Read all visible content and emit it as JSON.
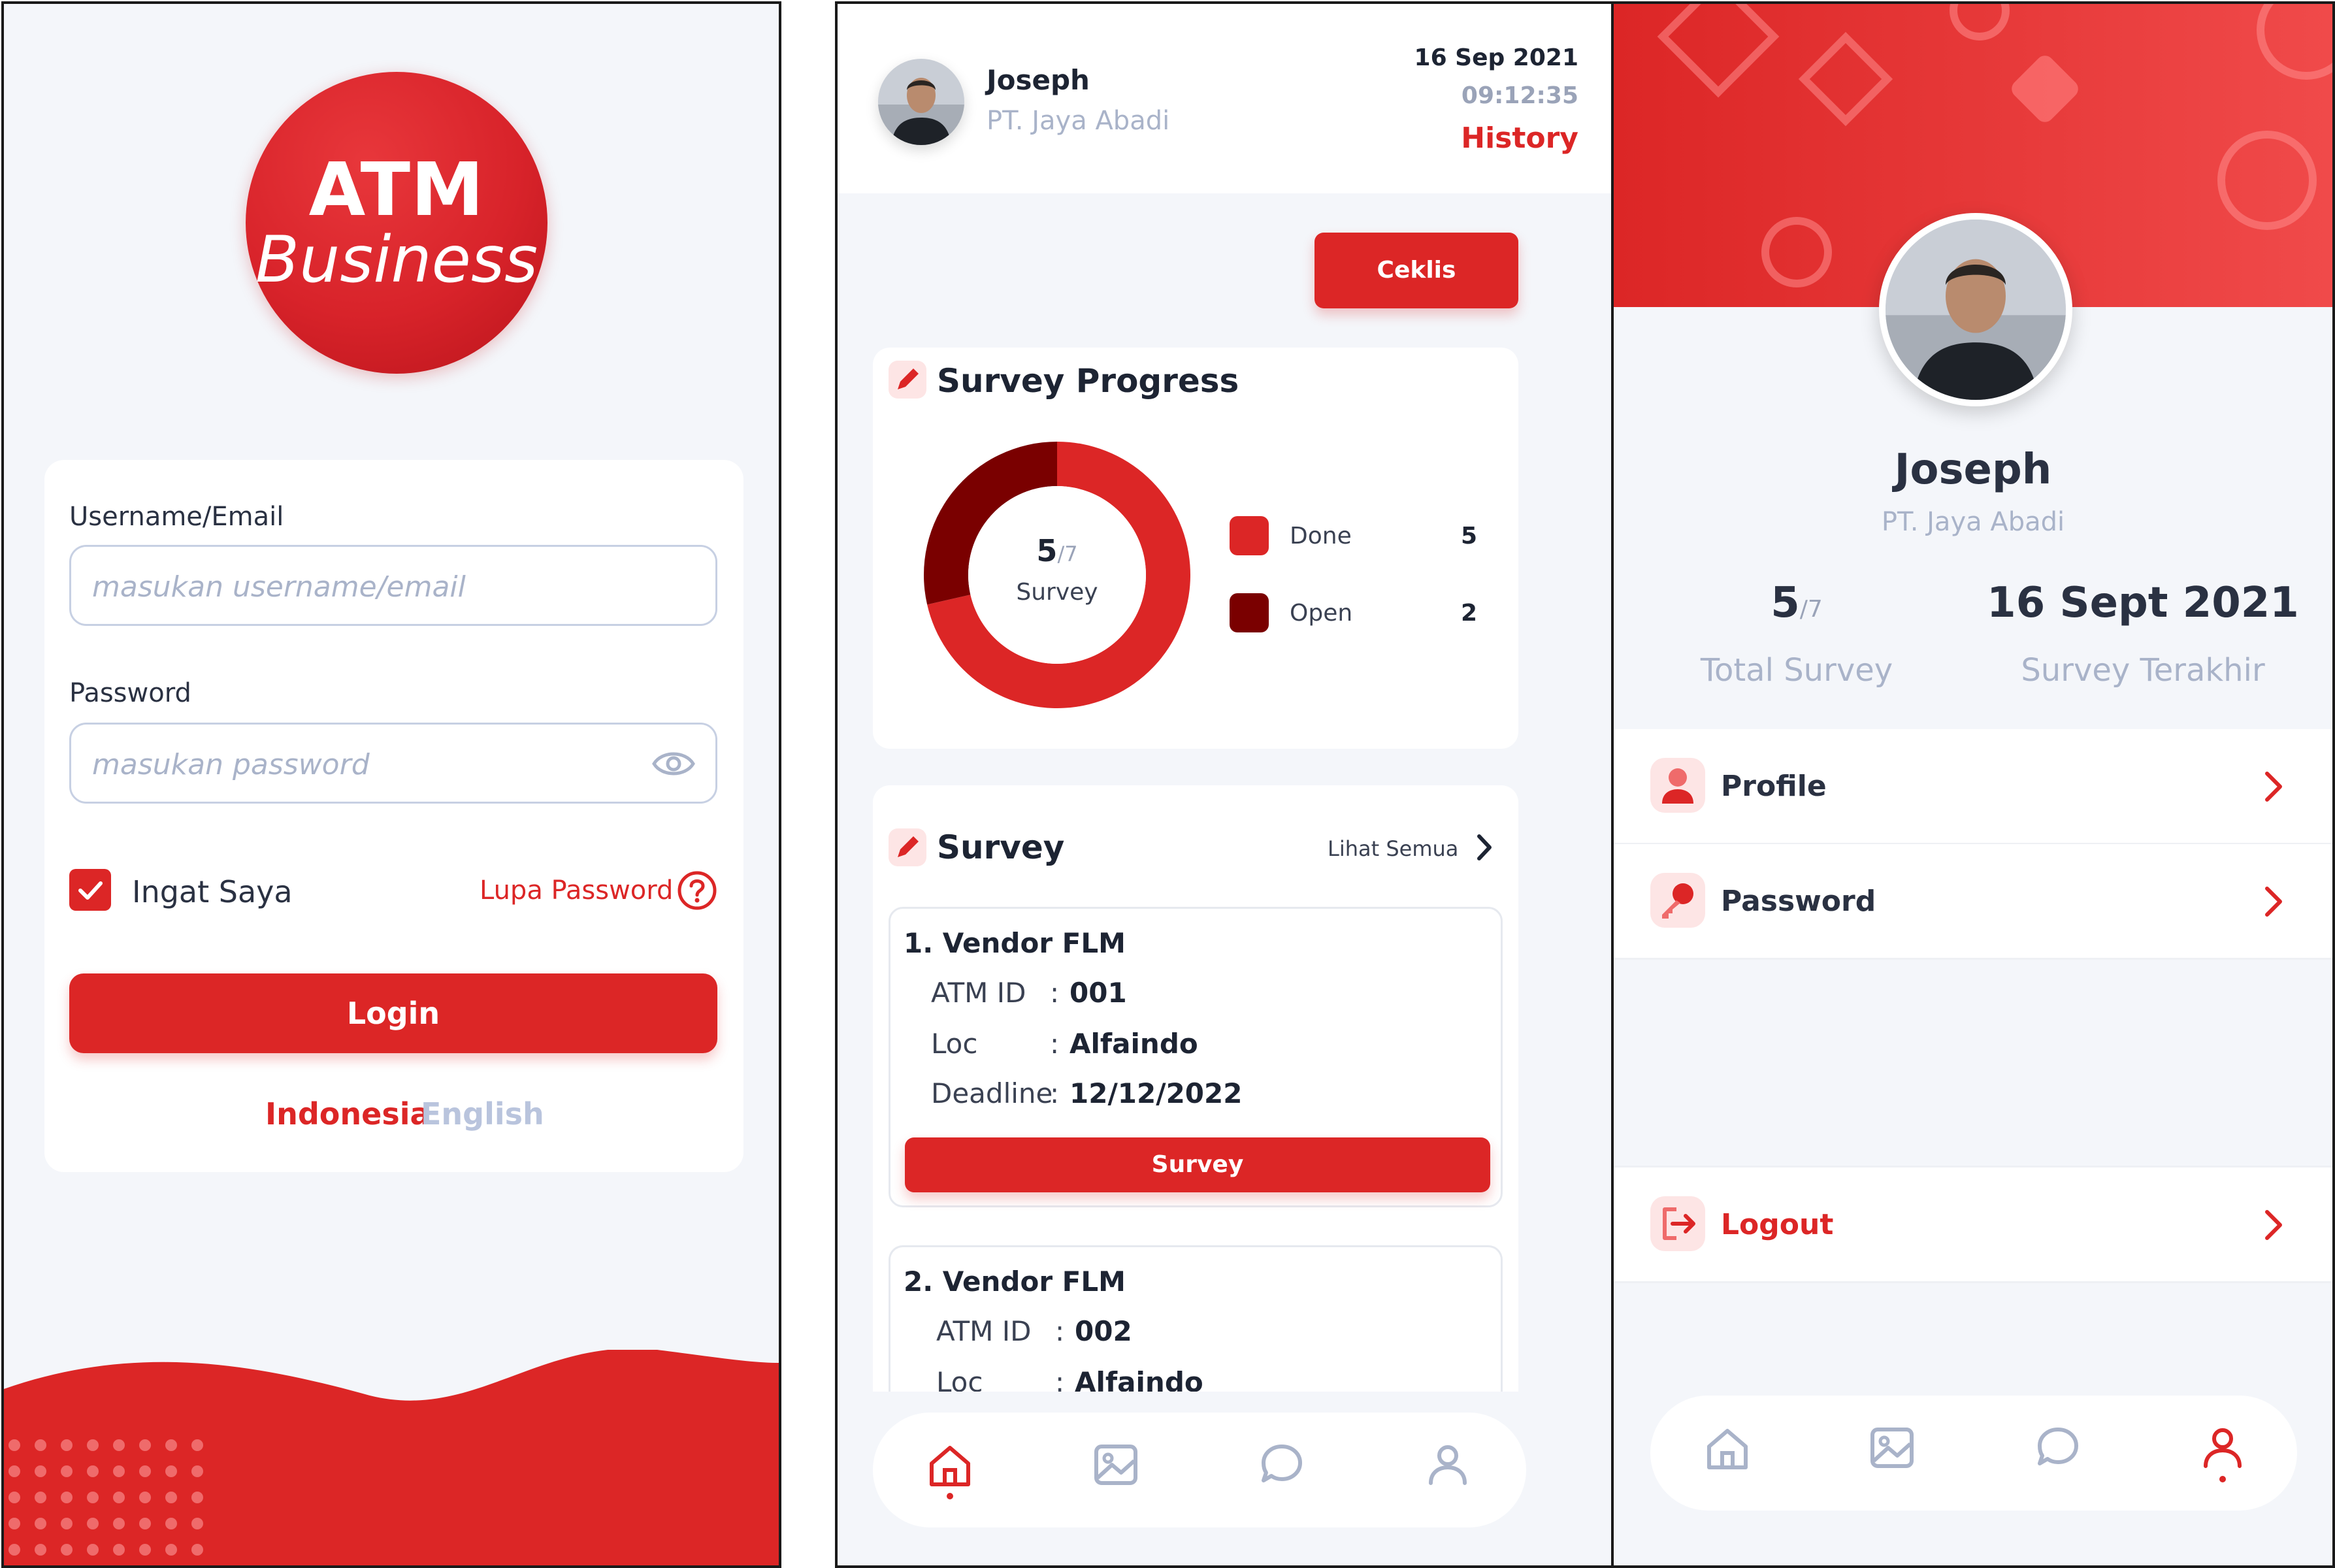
{
  "login": {
    "logo_line1": "ATM",
    "logo_line2": "Business",
    "username_label": "Username/Email",
    "username_placeholder": "masukan username/email",
    "password_label": "Password",
    "password_placeholder": "masukan password",
    "remember_label": "Ingat Saya",
    "remember_checked": true,
    "forgot_label": "Lupa Password",
    "login_button": "Login",
    "lang_id": "Indonesia",
    "lang_en": "English",
    "active_lang": "Indonesia"
  },
  "dashboard": {
    "user_name": "Joseph",
    "company": "PT. Jaya Abadi",
    "date": "16 Sep 2021",
    "time": "09:12:35",
    "history_link": "History",
    "ceklis_button": "Ceklis",
    "progress_title": "Survey Progress",
    "progress_center_value": "5",
    "progress_center_total": "/7",
    "progress_center_label": "Survey",
    "legend": [
      {
        "label": "Done",
        "value": "5",
        "color": "#dc2626"
      },
      {
        "label": "Open",
        "value": "2",
        "color": "#7a0000"
      }
    ],
    "survey_title": "Survey",
    "see_all": "Lihat Semua",
    "surveys": [
      {
        "title": "1. Vendor FLM",
        "atm_label": "ATM ID",
        "atm_id": "001",
        "loc_label": "Loc",
        "loc": "Alfaindo",
        "deadline_label": "Deadline",
        "deadline": "12/12/2022",
        "button": "Survey"
      },
      {
        "title": "2. Vendor FLM",
        "atm_label": "ATM ID",
        "atm_id": "002",
        "loc_label": "Loc",
        "loc": "Alfaindo"
      }
    ],
    "nav": [
      "home-icon",
      "image-icon",
      "chat-icon",
      "user-icon"
    ],
    "active_nav": "home-icon"
  },
  "profile": {
    "name": "Joseph",
    "company": "PT. Jaya Abadi",
    "total_value": "5",
    "total_of": "/7",
    "total_label": "Total Survey",
    "last_date": "16 Sept 2021",
    "last_label": "Survey Terakhir",
    "menu_profile": "Profile",
    "menu_password": "Password",
    "menu_logout": "Logout",
    "nav": [
      "home-icon",
      "image-icon",
      "chat-icon",
      "user-icon"
    ],
    "active_nav": "user-icon"
  },
  "colors": {
    "accent": "#dc2626",
    "dark_red": "#7a0000",
    "background": "#f4f6fa",
    "muted": "#a9b3c9"
  },
  "chart_data": {
    "type": "pie",
    "categories": [
      "Done",
      "Open"
    ],
    "values": [
      5,
      2
    ],
    "title": "Survey Progress"
  }
}
